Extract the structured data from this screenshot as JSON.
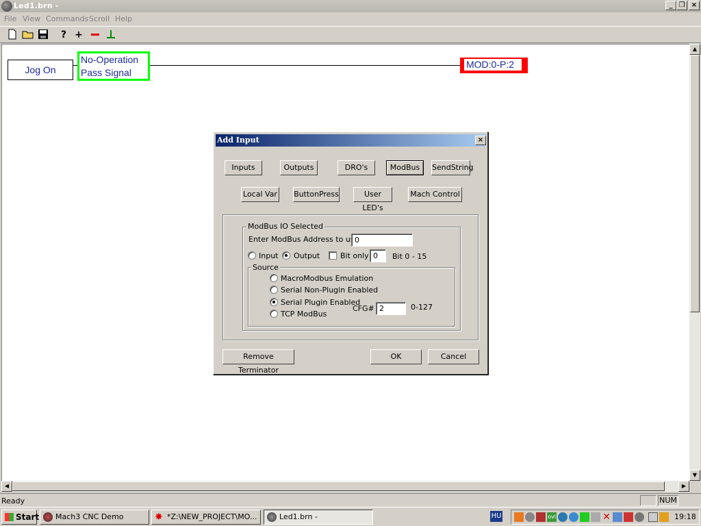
{
  "window": {
    "title": "Led1.brn -"
  },
  "menu": [
    "File",
    "View",
    "Commands",
    "Scroll",
    "Help"
  ],
  "toolbar": {
    "icons": [
      "new-file-icon",
      "open-folder-icon",
      "save-icon",
      "help-icon",
      "add-icon",
      "remove-icon",
      "terminator-icon"
    ]
  },
  "ladder": {
    "input_label": "Jog On",
    "op_line1": "No-Operation",
    "op_line2": "Pass Signal",
    "output_label": "MOD:0-P:2"
  },
  "dialog": {
    "title": "Add Input",
    "tabs_row1": [
      "Inputs",
      "Outputs",
      "DRO's",
      "ModBus",
      "SendString"
    ],
    "tabs_row2": [
      "Local Var",
      "ButtonPress",
      "User LED's",
      "Mach Control"
    ],
    "selected_tab": "ModBus",
    "group_title": "ModBus IO Selected",
    "address_label": "Enter ModBus Address to use",
    "address_value": "0",
    "input_label": "Input",
    "output_label": "Output",
    "bit_only_label": "Bit only",
    "bit_value": "0",
    "bit_range": "Bit 0 - 15",
    "source_title": "Source",
    "sources": [
      "MacroModbus Emulation",
      "Serial Non-Plugin Enabled",
      "Serial Plugin Enabled",
      "TCP ModBus"
    ],
    "selected_source": "Serial Plugin Enabled",
    "cfg_label": "CFG#",
    "cfg_value": "2",
    "cfg_range": "0-127",
    "remove_terminator": "Remove Terminator",
    "ok": "OK",
    "cancel": "Cancel"
  },
  "status": {
    "text": "Ready",
    "num": "NUM"
  },
  "taskbar": {
    "start": "Start",
    "tasks": [
      "Mach3 CNC  Demo",
      "*Z:\\NEW_PROJECT\\MO...",
      "Led1.brn -"
    ],
    "lang": "HU",
    "clock": "19:18"
  },
  "colors": {
    "selection_green": "#00ff00",
    "output_red": "#ff0000",
    "text_blue": "#1a2a9a",
    "title_blue": "#0a246a"
  }
}
